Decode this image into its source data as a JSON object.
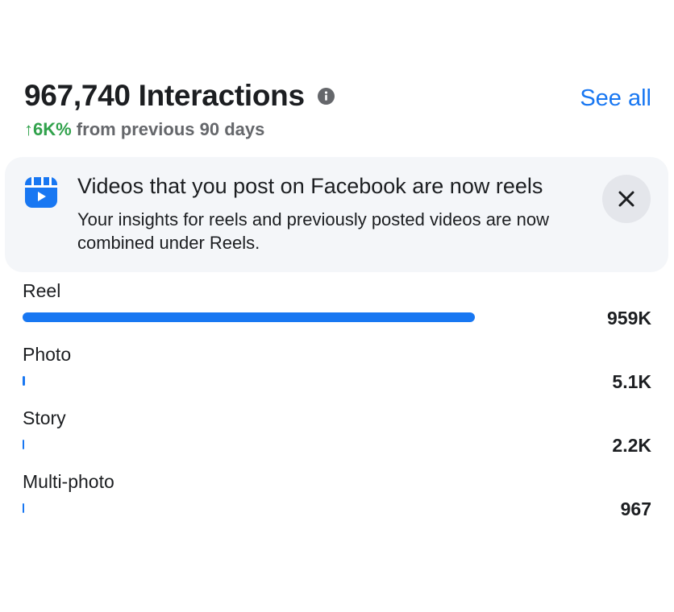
{
  "header": {
    "title": "967,740 Interactions",
    "see_all_label": "See all",
    "change_value": "↑6K%",
    "change_suffix": " from previous 90 days"
  },
  "banner": {
    "title": "Videos that you post on Facebook are now reels",
    "body": "Your insights for reels and previously posted videos are now combined under Reels.",
    "icon": "reels-icon",
    "close_icon": "close-icon"
  },
  "breakdown": [
    {
      "label": "Reel",
      "value": "959K",
      "share": 1.0
    },
    {
      "label": "Photo",
      "value": "5.1K",
      "share": 0.0053
    },
    {
      "label": "Story",
      "value": "2.2K",
      "share": 0.0023
    },
    {
      "label": "Multi-photo",
      "value": "967",
      "share": 0.001
    }
  ],
  "colors": {
    "accent": "#1877f2",
    "positive": "#31a24c",
    "secondary_text": "#65676b",
    "banner_bg": "#f4f6f9"
  }
}
